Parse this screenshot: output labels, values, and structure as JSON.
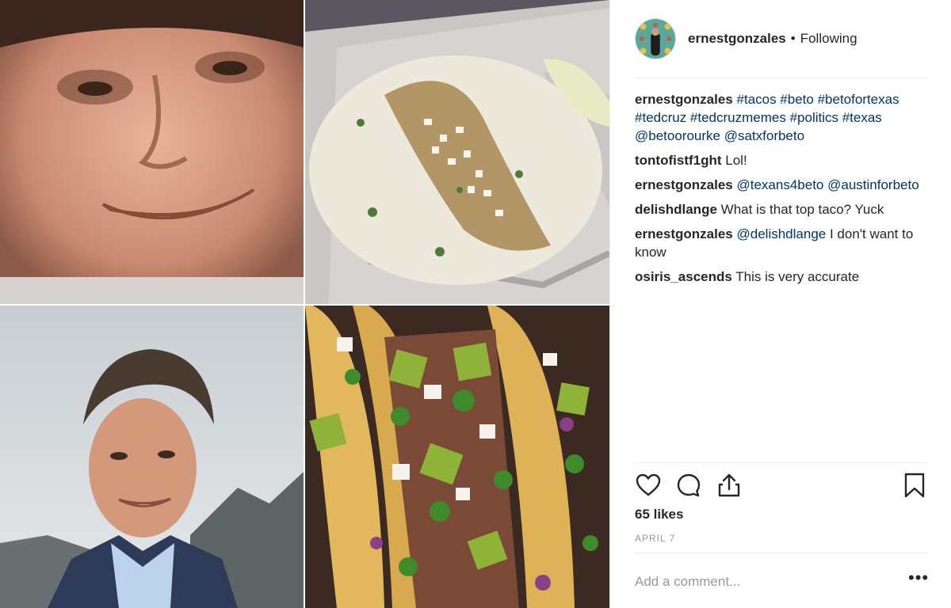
{
  "header": {
    "username": "ernestgonzales",
    "separator": "•",
    "follow_status": "Following"
  },
  "caption": {
    "username": "ernestgonzales",
    "tags_line1": "#tacos #beto #betofortexas",
    "tags_line2": "#tedcruz #tedcruzmemes #politics #texas",
    "mentions": "@betoorourke @satxforbeto"
  },
  "comments": [
    {
      "user": "tontofistf1ght",
      "text": "Lol!",
      "mention": ""
    },
    {
      "user": "ernestgonzales",
      "text": "",
      "mention": "@texans4beto @austinforbeto"
    },
    {
      "user": "delishdlange",
      "text": "What is that top taco? Yuck",
      "mention": ""
    },
    {
      "user": "ernestgonzales",
      "text": " I don't want to know",
      "mention": "@delishdlange"
    },
    {
      "user": "osiris_ascends",
      "text": "This is very accurate",
      "mention": ""
    }
  ],
  "icons": {
    "like": "heart-icon",
    "comment": "comment-bubble-icon",
    "share": "share-icon",
    "save": "bookmark-icon",
    "more": "more-options-icon"
  },
  "likes": "65 likes",
  "date": "APRIL 7",
  "add_comment": {
    "placeholder": "Add a comment...",
    "more_label": "•••"
  },
  "colors": {
    "link": "#003569",
    "text": "#262626",
    "muted": "#999999",
    "divider": "#efefef"
  }
}
